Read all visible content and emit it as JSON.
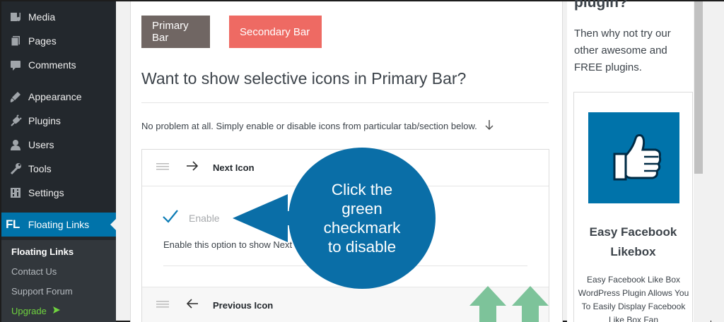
{
  "admin_menu": {
    "items": [
      {
        "label": "Media",
        "icon": "media-icon"
      },
      {
        "label": "Pages",
        "icon": "pages-icon"
      },
      {
        "label": "Comments",
        "icon": "comments-icon"
      },
      {
        "label": "Appearance",
        "icon": "appearance-icon"
      },
      {
        "label": "Plugins",
        "icon": "plugins-icon"
      },
      {
        "label": "Users",
        "icon": "users-icon"
      },
      {
        "label": "Tools",
        "icon": "tools-icon"
      },
      {
        "label": "Settings",
        "icon": "settings-icon"
      }
    ],
    "active": {
      "logo": "FL",
      "label": "Floating Links"
    },
    "submenu": [
      "Floating Links",
      "Contact Us",
      "Support Forum"
    ],
    "upgrade_label": "Upgrade",
    "colors": {
      "active_bg": "#0073aa",
      "sidebar_bg": "#23282d",
      "upgrade": "#6fd33f"
    }
  },
  "main": {
    "buttons": {
      "primary": "Primary Bar",
      "secondary": "Secondary Bar"
    },
    "heading": "Want to show selective icons in Primary Bar?",
    "description": "No problem at all. Simply enable or disable icons from particular tab/section below.",
    "next_row": {
      "title": "Next Icon"
    },
    "enable_label": "Enable",
    "option_description": "Enable this option to show Next",
    "prev_row": {
      "title": "Previous Icon"
    },
    "colors": {
      "primary_btn": "#706663",
      "secondary_btn": "#ee6a63",
      "checkmark": "#0a7bb5"
    }
  },
  "callout": {
    "text": "Click the\ngreen\ncheckmark\nto disable",
    "color": "#0a6ea7"
  },
  "right_sidebar": {
    "title_fragment": "plugin?",
    "promo_text": "Then why not try our other awesome and FREE plugins.",
    "card": {
      "icon": "thumbs-up-icon",
      "title": "Easy Facebook Likebox",
      "description": "Easy Facebook Like Box WordPress Plugin Allows You To Easily Display Facebook Like Box Fan"
    }
  }
}
